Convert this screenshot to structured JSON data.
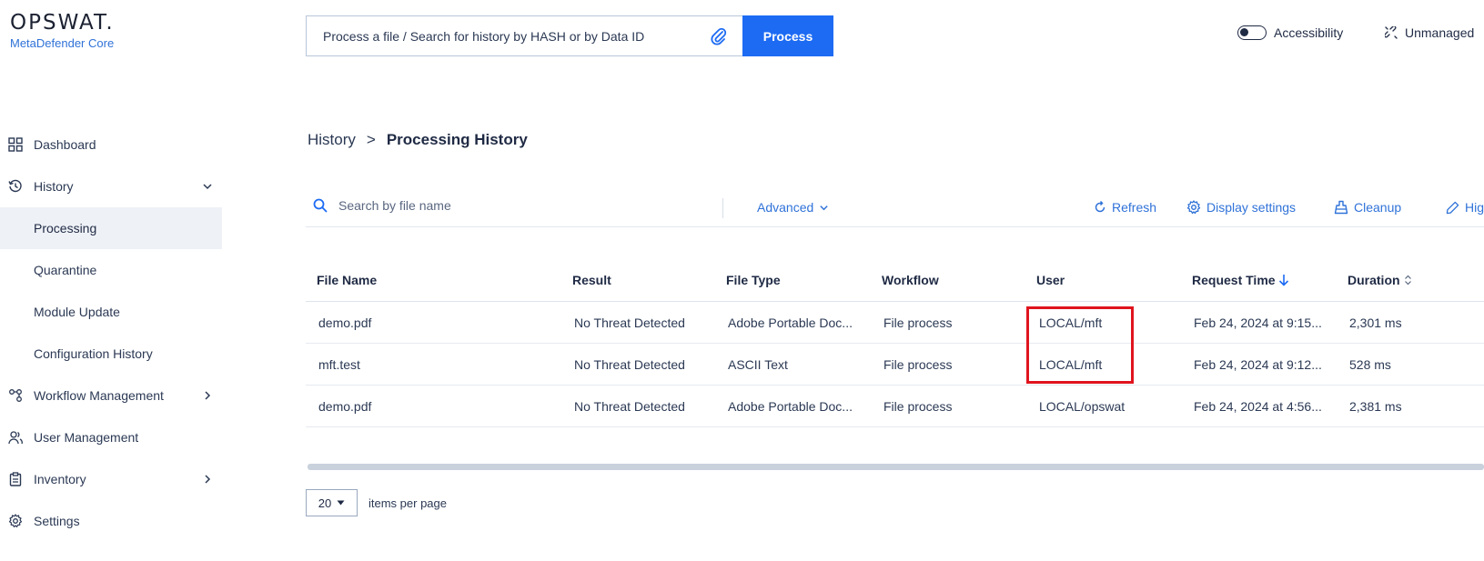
{
  "logo": {
    "main": "OPSWAT.",
    "sub": "MetaDefender Core"
  },
  "topbar": {
    "search_placeholder": "Process a file / Search for history by HASH or by Data ID",
    "process_label": "Process",
    "accessibility_label": "Accessibility",
    "unmanaged_label": "Unmanaged"
  },
  "sidebar": {
    "dashboard": "Dashboard",
    "history": "History",
    "history_children": [
      "Processing",
      "Quarantine",
      "Module Update",
      "Configuration History"
    ],
    "workflow": "Workflow Management",
    "user": "User Management",
    "inventory": "Inventory",
    "settings": "Settings"
  },
  "breadcrumb": {
    "parent": "History",
    "separator": ">",
    "current": "Processing History"
  },
  "toolbar": {
    "search_placeholder": "Search by file name",
    "advanced": "Advanced",
    "refresh": "Refresh",
    "display_settings": "Display settings",
    "cleanup": "Cleanup",
    "highlight": "Hig"
  },
  "table": {
    "headers": {
      "file_name": "File Name",
      "result": "Result",
      "file_type": "File Type",
      "workflow": "Workflow",
      "user": "User",
      "request_time": "Request Time",
      "duration": "Duration"
    },
    "rows": [
      {
        "file_name": "demo.pdf",
        "result": "No Threat Detected",
        "file_type": "Adobe Portable Doc...",
        "workflow": "File process",
        "user": "LOCAL/mft",
        "request_time": "Feb 24, 2024 at 9:15...",
        "duration": "2,301 ms"
      },
      {
        "file_name": "mft.test",
        "result": "No Threat Detected",
        "file_type": "ASCII Text",
        "workflow": "File process",
        "user": "LOCAL/mft",
        "request_time": "Feb 24, 2024 at 9:12...",
        "duration": "528 ms"
      },
      {
        "file_name": "demo.pdf",
        "result": "No Threat Detected",
        "file_type": "Adobe Portable Doc...",
        "workflow": "File process",
        "user": "LOCAL/opswat",
        "request_time": "Feb 24, 2024 at 4:56...",
        "duration": "2,381 ms"
      }
    ]
  },
  "pager": {
    "page_size": "20",
    "label": "items per page"
  },
  "colors": {
    "accent": "#1d6bf3",
    "link": "#2f72d8",
    "highlight": "#e0141e",
    "active_bg": "#eef1f6"
  }
}
